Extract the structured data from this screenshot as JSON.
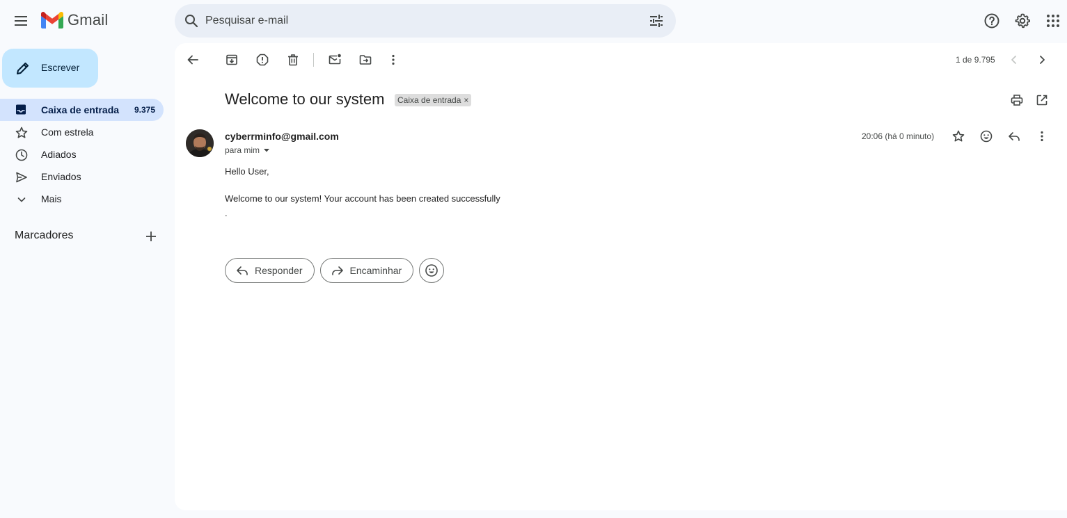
{
  "app": {
    "logo_text": "Gmail"
  },
  "search": {
    "placeholder": "Pesquisar e-mail"
  },
  "compose": {
    "label": "Escrever"
  },
  "sidebar": {
    "items": [
      {
        "label": "Caixa de entrada",
        "count": "9.375",
        "icon": "inbox-icon",
        "active": true
      },
      {
        "label": "Com estrela",
        "count": "",
        "icon": "star-icon"
      },
      {
        "label": "Adiados",
        "count": "",
        "icon": "clock-icon"
      },
      {
        "label": "Enviados",
        "count": "",
        "icon": "send-icon"
      },
      {
        "label": "Mais",
        "count": "",
        "icon": "chevron-down-icon"
      }
    ],
    "labels_title": "Marcadores"
  },
  "toolbar": {
    "pager": "1 de 9.795"
  },
  "email": {
    "subject": "Welcome to our system",
    "label_chip": "Caixa de entrada",
    "sender": "cyberrminfo@gmail.com",
    "to": "para mim",
    "time": "20:06 (há 0 minuto)",
    "body": {
      "greeting": "Hello User,",
      "line1": "Welcome to our system! Your account has been created successfully",
      "line2": "."
    }
  },
  "actions": {
    "reply": "Responder",
    "forward": "Encaminhar"
  },
  "colors": {
    "background": "#f8fafd",
    "compose_bg": "#c2e7ff",
    "active_nav_bg": "#d3e3fd",
    "search_bg": "#e9eef6"
  }
}
